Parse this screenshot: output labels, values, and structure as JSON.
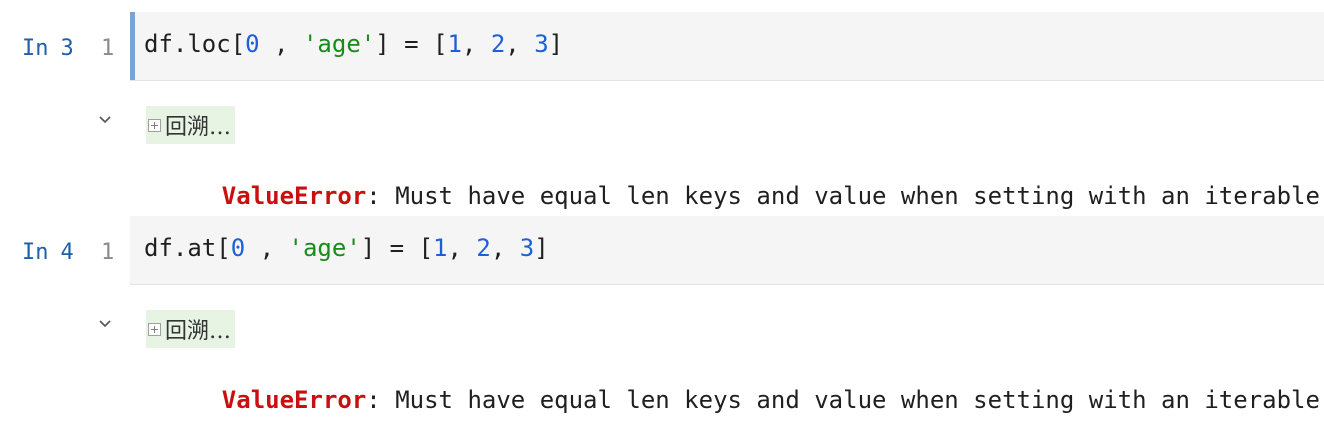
{
  "cells": [
    {
      "prompt_label": "In",
      "execution_count": "3",
      "line_number": "1",
      "code": {
        "prefix": "df.loc[",
        "arg_num": "0",
        "sep": " , ",
        "arg_str": "'age'",
        "assign": "] = [",
        "v1": "1",
        "c1": ", ",
        "v2": "2",
        "c2": ", ",
        "v3": "3",
        "end": "]"
      },
      "output": {
        "traceback_label": "回溯…",
        "error_type": "ValueError",
        "error_message": ": Must have equal len keys and value when setting with an iterable"
      }
    },
    {
      "prompt_label": "In",
      "execution_count": "4",
      "line_number": "1",
      "code": {
        "prefix": "df.at[",
        "arg_num": "0",
        "sep": " , ",
        "arg_str": "'age'",
        "assign": "] = [",
        "v1": "1",
        "c1": ", ",
        "v2": "2",
        "c2": ", ",
        "v3": "3",
        "end": "]"
      },
      "output": {
        "traceback_label": "回溯…",
        "error_type": "ValueError",
        "error_message": ": Must have equal len keys and value when setting with an iterable"
      }
    }
  ],
  "colors": {
    "prompt": "#1f5fa8",
    "number_token": "#1c5fd6",
    "string_token": "#1a8a1a",
    "error_type": "#c81010",
    "editor_background": "#f5f5f5",
    "active_cell_marker": "#7aa3d1",
    "traceback_background": "#e7f4e4"
  },
  "icons": {
    "collapse": "chevron-down-icon",
    "expand": "plus-box-icon"
  }
}
